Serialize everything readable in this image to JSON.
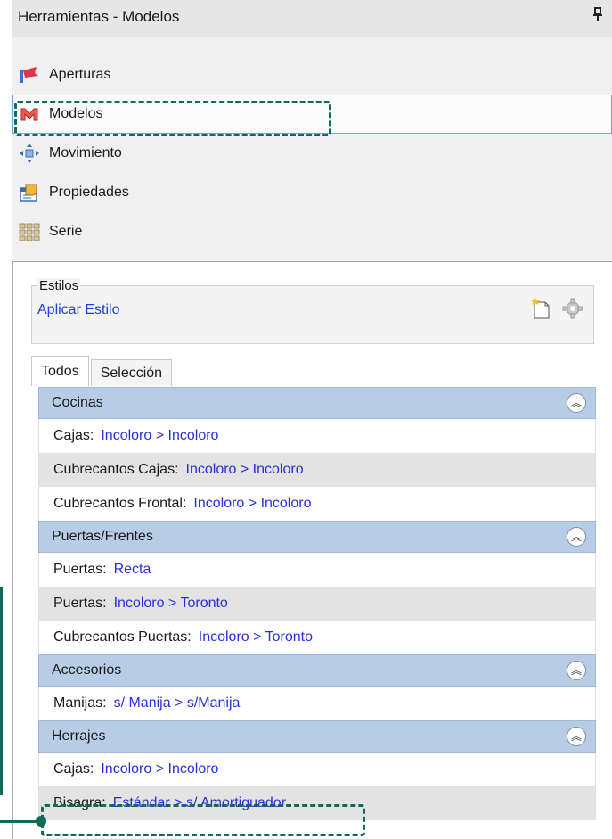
{
  "window": {
    "title": "Herramientas - Modelos",
    "pin_glyph": "p"
  },
  "nav": {
    "items": [
      {
        "label": "Aperturas",
        "icon": "aperturas-icon"
      },
      {
        "label": "Modelos",
        "icon": "modelos-icon",
        "selected": true
      },
      {
        "label": "Movimiento",
        "icon": "movimiento-icon"
      },
      {
        "label": "Propiedades",
        "icon": "propiedades-icon"
      },
      {
        "label": "Serie",
        "icon": "serie-icon"
      }
    ]
  },
  "estilos": {
    "caption": "Estilos",
    "apply_link": "Aplicar Estilo"
  },
  "tabs": [
    {
      "label": "Todos",
      "active": true
    },
    {
      "label": "Selección",
      "active": false
    }
  ],
  "groups": [
    {
      "title": "Cocinas",
      "rows": [
        {
          "key": "Cajas:",
          "value": "Incoloro > Incoloro"
        },
        {
          "key": "Cubrecantos Cajas:",
          "value": "Incoloro > Incoloro"
        },
        {
          "key": "Cubrecantos Frontal:",
          "value": "Incoloro > Incoloro"
        }
      ]
    },
    {
      "title": "Puertas/Frentes",
      "rows": [
        {
          "key": "Puertas:",
          "value": "Recta"
        },
        {
          "key": "Puertas:",
          "value": "Incoloro > Toronto"
        },
        {
          "key": "Cubrecantos Puertas:",
          "value": "Incoloro > Toronto"
        }
      ]
    },
    {
      "title": "Accesorios",
      "rows": [
        {
          "key": "Manijas:",
          "value": "s/ Manija > s/Manija"
        }
      ]
    },
    {
      "title": "Herrajes",
      "rows": [
        {
          "key": "Cajas:",
          "value": "Incoloro > Incoloro"
        },
        {
          "key": "Bisagra:",
          "value": "Estándar > s/ Amortiguador"
        }
      ]
    }
  ],
  "colors": {
    "group_header": "#b7cde6",
    "value_link": "#2a2ee0",
    "highlight": "#0f6a5a",
    "selection_border": "#7aa1d2"
  }
}
